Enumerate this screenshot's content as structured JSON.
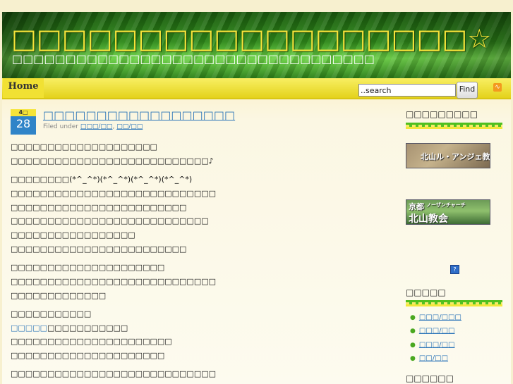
{
  "header": {
    "site_title": "□□□□□□□□□□□□□□□□□□☆",
    "site_description": "□□□□□□□□□□□□□□□□□□□□□□□□□□□□□□□□□□"
  },
  "nav": {
    "home_label": "Home"
  },
  "search": {
    "value": "..search",
    "button_label": "Find"
  },
  "post": {
    "date_month": "4□",
    "date_day": "28",
    "title": "□□□□□□□□□□□□□□□□□□",
    "filed_under": "Filed under",
    "categories": [
      "□□□/□□",
      "□□/□□"
    ],
    "category_separator": ",",
    "lines": [
      "□□□□□□□□□□□□□□□□□□□□",
      "□□□□□□□□□□□□□□□□□□□□□□□□□□□♪",
      "□□□□□□□□(*^_^*)(*^_^*)(*^_^*)(*^_^*)",
      "□□□□□□□□□□□□□□□□□□□□□□□□□□□□",
      "□□□□□□□□□□□□□□□□□□□□□□□□",
      "□□□□□□□□□□□□□□□□□□□□□□□□□□□",
      "□□□□□□□□□□□□□□□□□",
      "□□□□□□□□□□□□□□□□□□□□□□□□",
      "□□□□□□□□□□□□□□□□□□□□□",
      "□□□□□□□□□□□□□□□□□□□□□□□□□□□□",
      "□□□□□□□□□□□□□",
      "□□□□□□□□□□□",
      "□□□□□□□□□□□□□□□□□□□□□□",
      "□□□□□□□□□□□□□□□□□□□□□",
      "□□□□□□□□□□□□□□□□□□□□□□□□□□□□"
    ],
    "link_prefix": "□□□□□",
    "link_suffix": "□□□□□□□□□□□"
  },
  "sidebar": {
    "widget1_title": "□□□□□□□□□",
    "banner1_text": "北山ル・アンジェ教会",
    "banner2_line1": "京都",
    "banner2_line2": "ノーザンチャーチ",
    "banner2_line3": "北山教会",
    "help_icon": "?",
    "categories_title": "□□□□□",
    "categories": [
      "□□□/□□□",
      "□□□/□□",
      "□□□/□□",
      "□□/□□"
    ],
    "next_title": "□□□□□□"
  },
  "colors": {
    "title_yellow": "#f6e33a",
    "link_blue": "#2a74b8",
    "date_blue": "#2f84c8",
    "nav_yellow": "#f1e133",
    "header_green": "#2f8a1a",
    "rss_orange": "#f39a1e"
  },
  "icons": {
    "rss": "rss-icon",
    "help": "help-icon",
    "bullet": "bullet-icon"
  }
}
